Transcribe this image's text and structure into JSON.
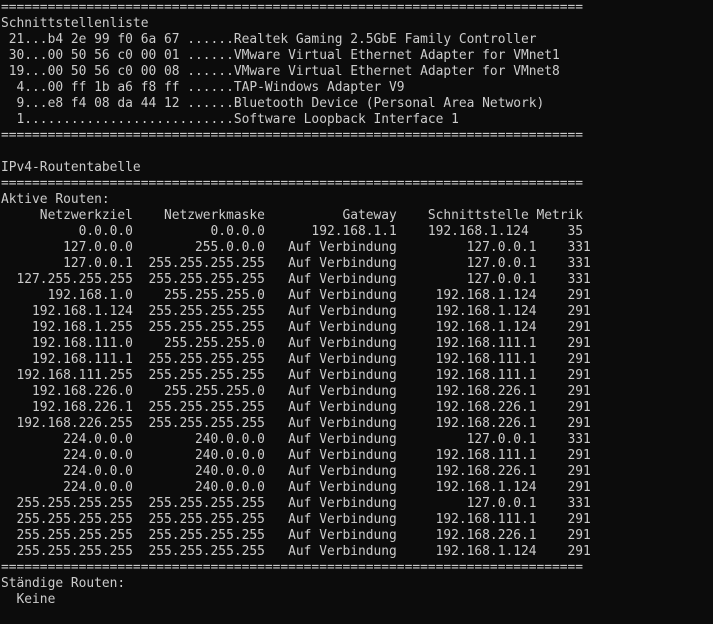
{
  "terminal": {
    "background": "#0c0c0c",
    "foreground": "#cccccc"
  },
  "lines": [
    "===========================================================================",
    "Schnittstellenliste",
    " 21...b4 2e 99 f0 6a 67 ......Realtek Gaming 2.5GbE Family Controller",
    " 30...00 50 56 c0 00 01 ......VMware Virtual Ethernet Adapter for VMnet1",
    " 19...00 50 56 c0 00 08 ......VMware Virtual Ethernet Adapter for VMnet8",
    "  4...00 ff 1b a6 f8 ff ......TAP-Windows Adapter V9",
    "  9...e8 f4 08 da 44 12 ......Bluetooth Device (Personal Area Network)",
    "  1...........................Software Loopback Interface 1",
    "===========================================================================",
    "",
    "IPv4-Routentabelle",
    "===========================================================================",
    "Aktive Routen:",
    "     Netzwerkziel    Netzwerkmaske          Gateway    Schnittstelle Metrik",
    "          0.0.0.0          0.0.0.0      192.168.1.1    192.168.1.124     35",
    "        127.0.0.0        255.0.0.0   Auf Verbindung         127.0.0.1    331",
    "        127.0.0.1  255.255.255.255   Auf Verbindung         127.0.0.1    331",
    "  127.255.255.255  255.255.255.255   Auf Verbindung         127.0.0.1    331",
    "      192.168.1.0    255.255.255.0   Auf Verbindung     192.168.1.124    291",
    "    192.168.1.124  255.255.255.255   Auf Verbindung     192.168.1.124    291",
    "    192.168.1.255  255.255.255.255   Auf Verbindung     192.168.1.124    291",
    "    192.168.111.0    255.255.255.0   Auf Verbindung     192.168.111.1    291",
    "    192.168.111.1  255.255.255.255   Auf Verbindung     192.168.111.1    291",
    "  192.168.111.255  255.255.255.255   Auf Verbindung     192.168.111.1    291",
    "    192.168.226.0    255.255.255.0   Auf Verbindung     192.168.226.1    291",
    "    192.168.226.1  255.255.255.255   Auf Verbindung     192.168.226.1    291",
    "  192.168.226.255  255.255.255.255   Auf Verbindung     192.168.226.1    291",
    "        224.0.0.0        240.0.0.0   Auf Verbindung         127.0.0.1    331",
    "        224.0.0.0        240.0.0.0   Auf Verbindung     192.168.111.1    291",
    "        224.0.0.0        240.0.0.0   Auf Verbindung     192.168.226.1    291",
    "        224.0.0.0        240.0.0.0   Auf Verbindung     192.168.1.124    291",
    "  255.255.255.255  255.255.255.255   Auf Verbindung         127.0.0.1    331",
    "  255.255.255.255  255.255.255.255   Auf Verbindung     192.168.111.1    291",
    "  255.255.255.255  255.255.255.255   Auf Verbindung     192.168.226.1    291",
    "  255.255.255.255  255.255.255.255   Auf Verbindung     192.168.1.124    291",
    "===========================================================================",
    "Ständige Routen:",
    "  Keine"
  ]
}
